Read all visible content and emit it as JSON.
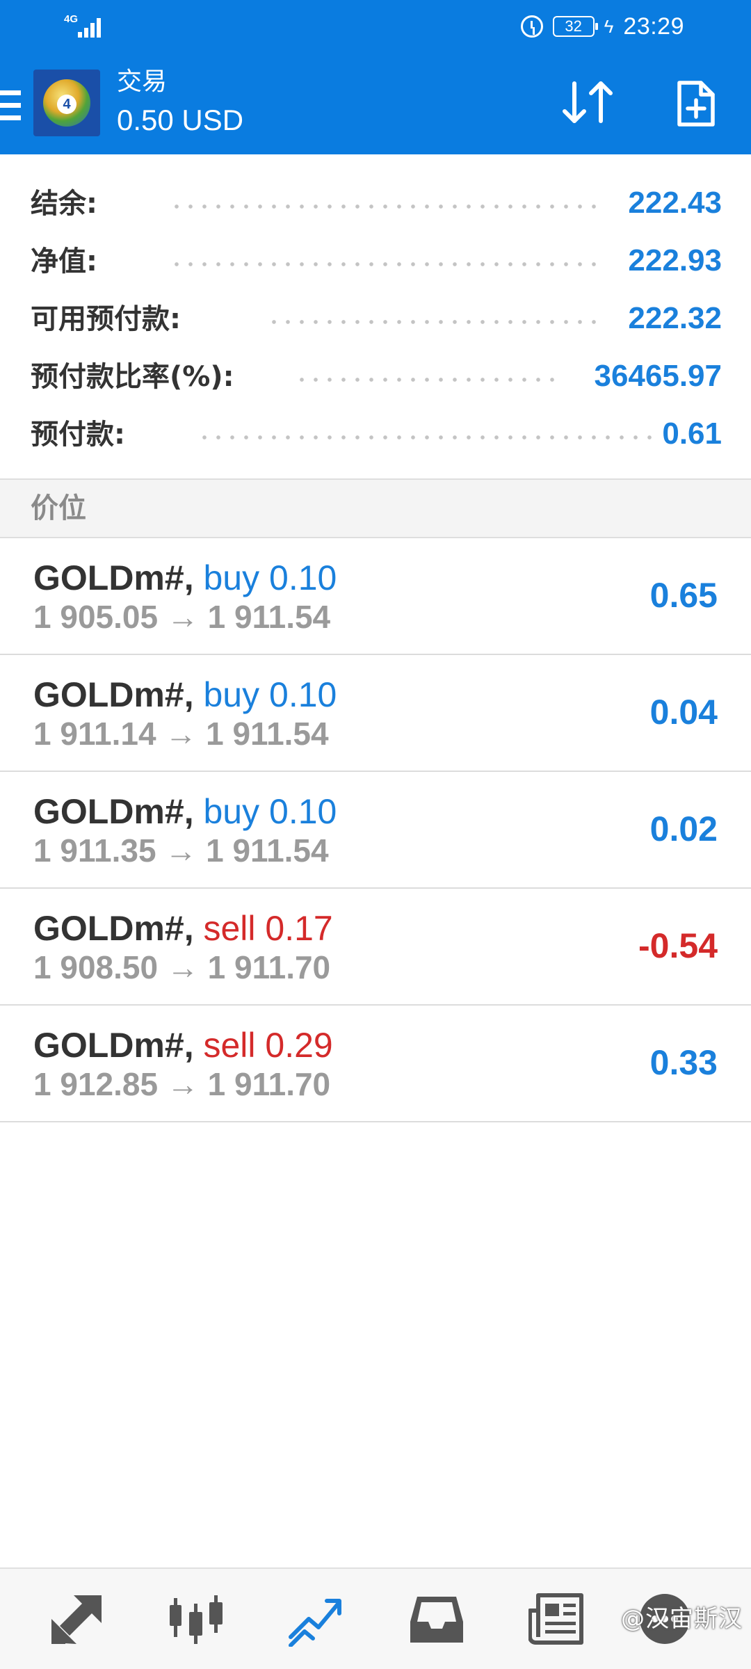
{
  "status_bar": {
    "network": "4G",
    "battery": "32",
    "time": "23:29"
  },
  "header": {
    "title": "交易",
    "subtitle": "0.50 USD"
  },
  "account": [
    {
      "label": "结余:",
      "value": "222.43"
    },
    {
      "label": "净值:",
      "value": "222.93"
    },
    {
      "label": "可用预付款:",
      "value": "222.32"
    },
    {
      "label": "预付款比率(%):",
      "value": "36465.97"
    },
    {
      "label": "预付款:",
      "value": "0.61"
    }
  ],
  "section": {
    "title": "价位"
  },
  "positions": [
    {
      "symbol": "GOLDm#,",
      "side": "buy 0.10",
      "prices": "1 905.05 → 1 911.54",
      "profit": "0.65"
    },
    {
      "symbol": "GOLDm#,",
      "side": "buy 0.10",
      "prices": "1 911.14 → 1 911.54",
      "profit": "0.04"
    },
    {
      "symbol": "GOLDm#,",
      "side": "buy 0.10",
      "prices": "1 911.35 → 1 911.54",
      "profit": "0.02"
    },
    {
      "symbol": "GOLDm#,",
      "side": "sell 0.17",
      "prices": "1 908.50 → 1 911.70",
      "profit": "-0.54"
    },
    {
      "symbol": "GOLDm#,",
      "side": "sell 0.29",
      "prices": "1 912.85 → 1 911.70",
      "profit": "0.33"
    }
  ],
  "bottom_nav": {
    "items": [
      "quotes-icon",
      "chart-icon",
      "trade-icon",
      "history-icon",
      "news-icon",
      "messages-icon"
    ],
    "active": "trade-icon",
    "active_color": "#1a80dc",
    "inactive_color": "#555555"
  },
  "colors": {
    "header_bg": "#0a7ce0",
    "value_blue": "#1a80dc",
    "loss_red": "#d42a2a"
  },
  "watermark": "@汉宙斯汉"
}
